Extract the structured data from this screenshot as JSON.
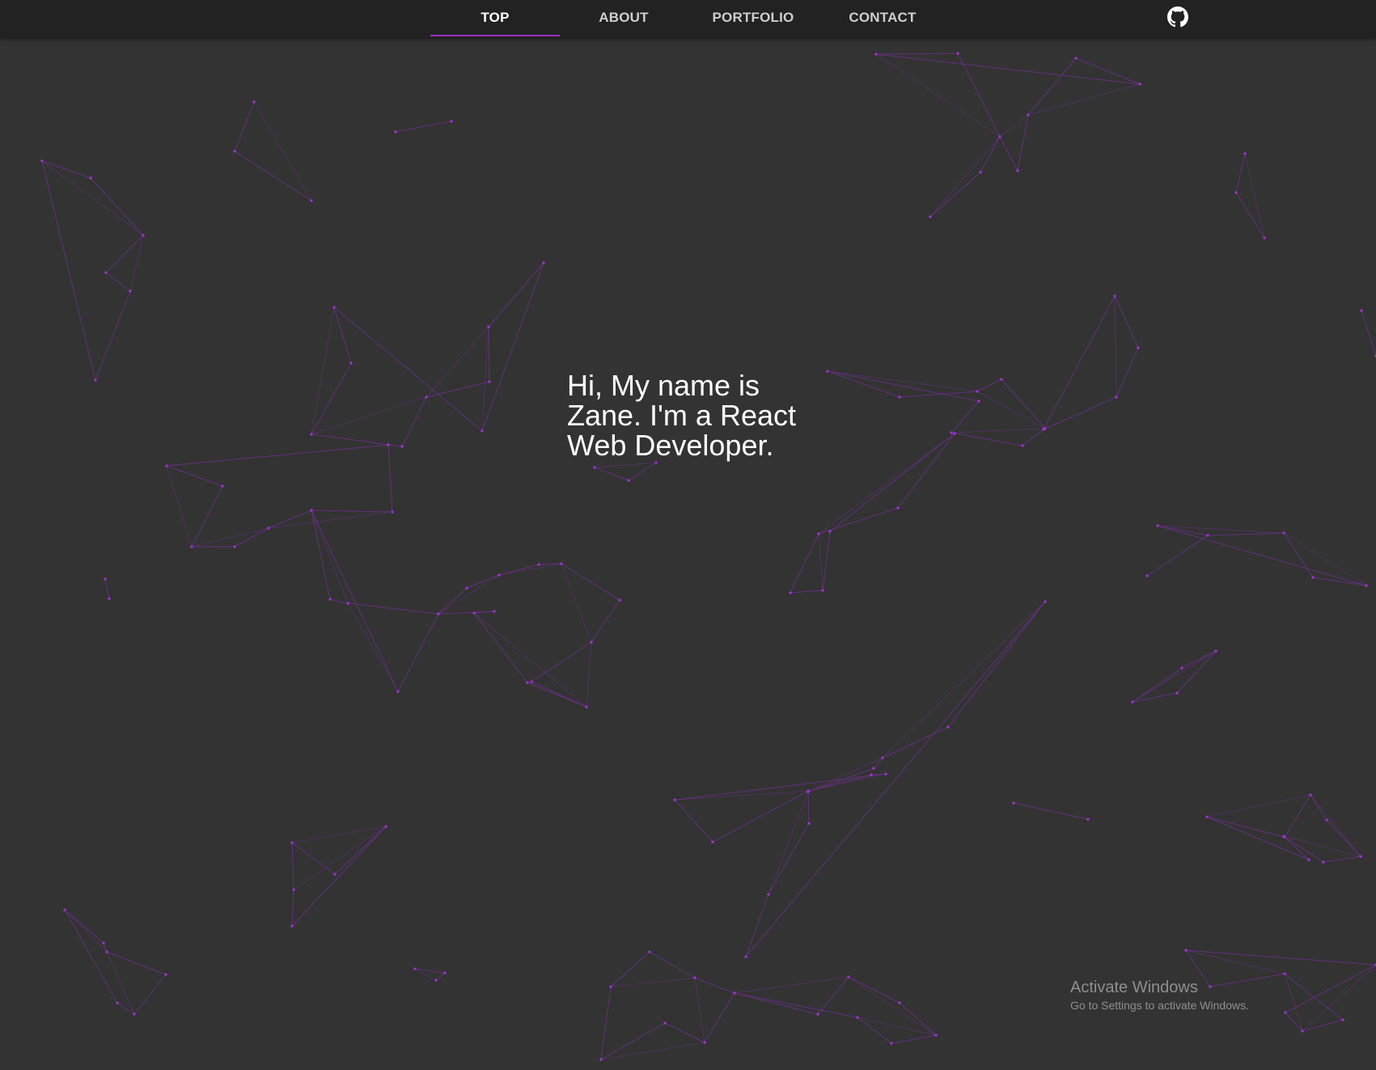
{
  "nav": {
    "items": [
      {
        "label": "TOP",
        "active": true
      },
      {
        "label": "ABOUT",
        "active": false
      },
      {
        "label": "PORTFOLIO",
        "active": false
      },
      {
        "label": "CONTACT",
        "active": false
      }
    ],
    "github_icon": "github-icon",
    "active_underline_color": "#9a2fc4"
  },
  "hero": {
    "line1": "Hi, My name is",
    "line2": "Zane. I'm a React",
    "line3": "Web Developer."
  },
  "background": {
    "color": "#333333",
    "particle_color": "#9b30c9"
  },
  "watermark": {
    "title": "Activate Windows",
    "subtitle": "Go to Settings to activate Windows."
  }
}
